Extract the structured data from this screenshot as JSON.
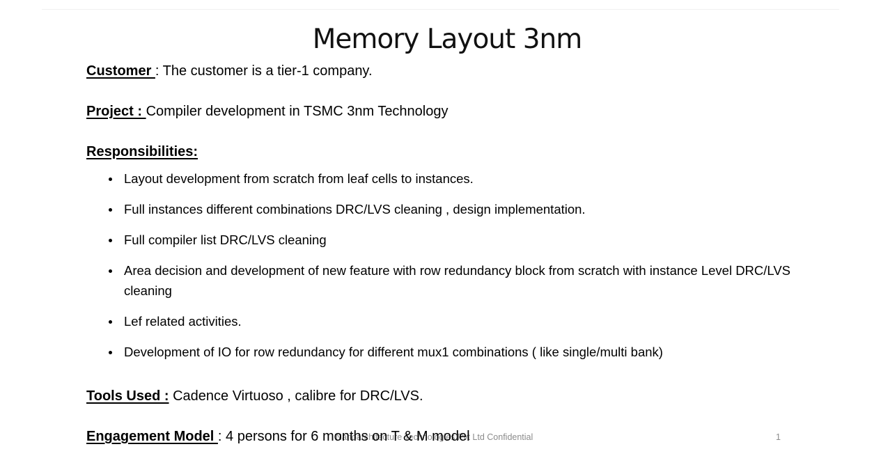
{
  "slide": {
    "title": "Memory Layout 3nm",
    "customer": {
      "label": "Customer ",
      "text": ": The customer is a tier-1 company."
    },
    "project": {
      "label": "Project  : ",
      "text": " Compiler development in TSMC 3nm Technology"
    },
    "responsibilities": {
      "label": "Responsibilities:",
      "items": [
        "Layout development from scratch from leaf cells to instances.",
        "Full instances different combinations DRC/LVS cleaning , design implementation.",
        "Full compiler list DRC/LVS cleaning",
        "Area decision and development of new feature with row redundancy block from scratch with instance Level DRC/LVS cleaning",
        "Lef related activities.",
        "Development of IO for row redundancy for different mux1 combinations ( like single/multi bank)"
      ]
    },
    "tools": {
      "label": "Tools Used :",
      "text": " Cadence Virtuoso , calibre for DRC/LVS."
    },
    "engagement": {
      "label": "Engagement Model ",
      "text": ": 4 persons for 6 months on T & M model"
    }
  },
  "footer": {
    "company": "Nanoarchitecture Technologies Pvt Ltd Confidential",
    "page_number": "1"
  }
}
